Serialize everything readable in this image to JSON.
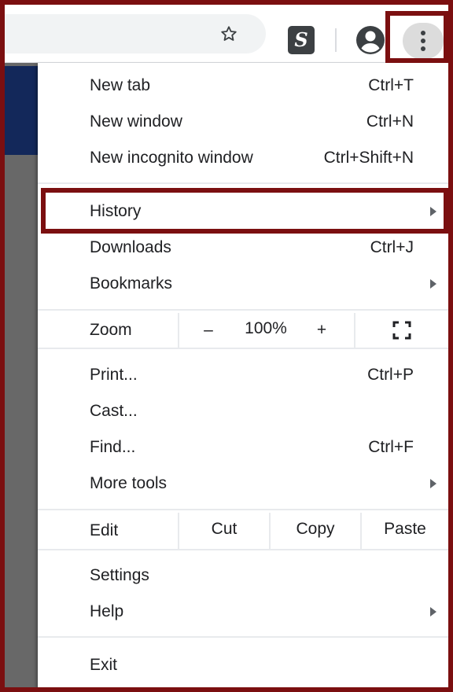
{
  "toolbar": {
    "star_icon": "star-outline-icon",
    "extension_icon_text": "S",
    "account_icon": "account-circle-icon",
    "menu_icon": "three-dot-vertical-icon"
  },
  "menu": {
    "new_tab": {
      "label": "New tab",
      "shortcut": "Ctrl+T"
    },
    "new_window": {
      "label": "New window",
      "shortcut": "Ctrl+N"
    },
    "new_incognito": {
      "label": "New incognito window",
      "shortcut": "Ctrl+Shift+N"
    },
    "history": {
      "label": "History"
    },
    "downloads": {
      "label": "Downloads",
      "shortcut": "Ctrl+J"
    },
    "bookmarks": {
      "label": "Bookmarks"
    },
    "zoom": {
      "label": "Zoom",
      "minus": "–",
      "value": "100%",
      "plus": "+"
    },
    "print": {
      "label": "Print...",
      "shortcut": "Ctrl+P"
    },
    "cast": {
      "label": "Cast..."
    },
    "find": {
      "label": "Find...",
      "shortcut": "Ctrl+F"
    },
    "more_tools": {
      "label": "More tools"
    },
    "edit": {
      "label": "Edit",
      "cut": "Cut",
      "copy": "Copy",
      "paste": "Paste"
    },
    "settings": {
      "label": "Settings"
    },
    "help": {
      "label": "Help"
    },
    "exit": {
      "label": "Exit"
    }
  },
  "colors": {
    "highlight_frame": "#7b0f10",
    "page_header": "#13285a",
    "page_side": "#686868"
  }
}
